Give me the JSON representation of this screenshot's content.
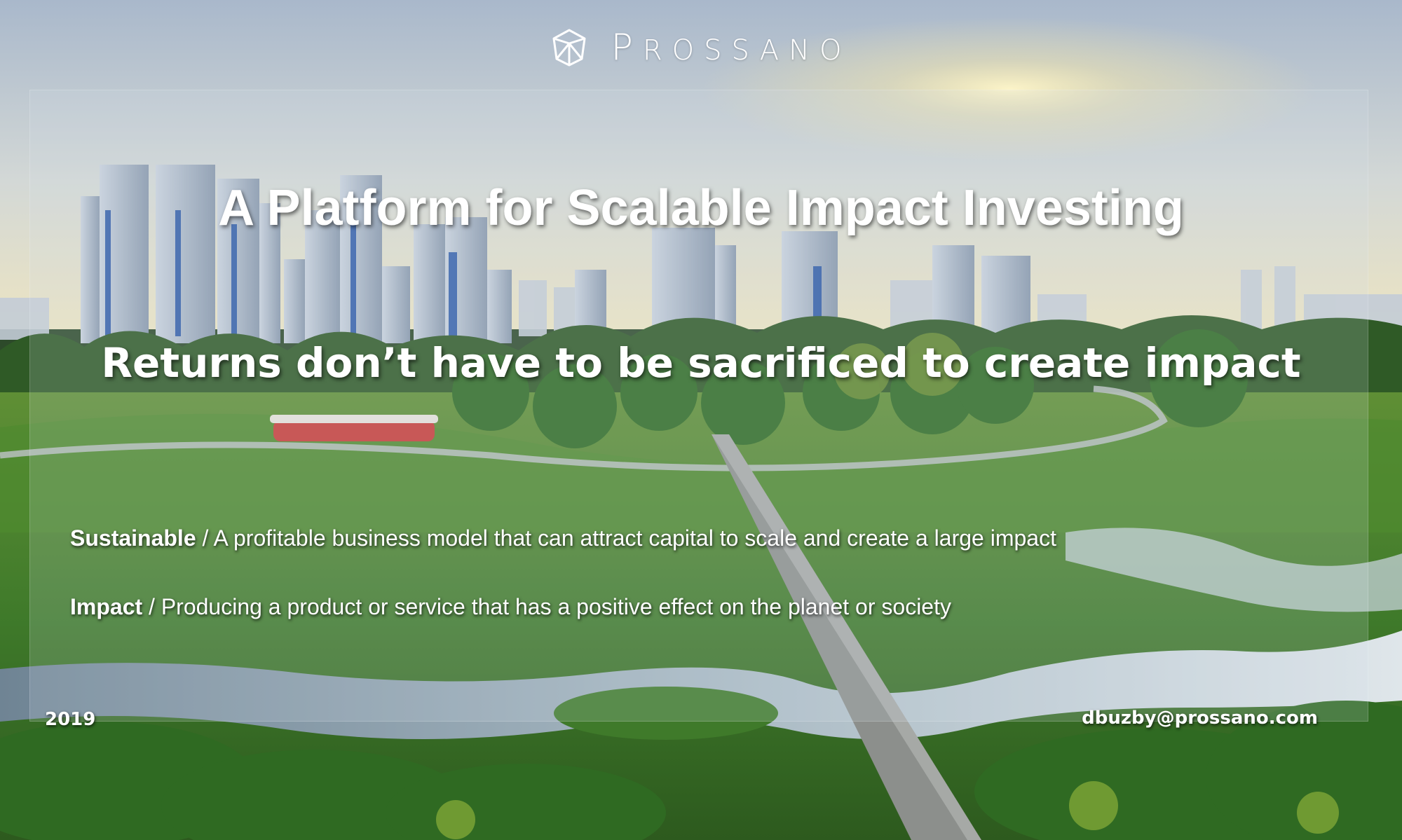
{
  "logo": {
    "icon": "geometric-gem-icon",
    "name": "PROSSANO",
    "first_letter": "P",
    "rest_letters": "ROSSANO"
  },
  "title": "A Platform for Scalable Impact Investing",
  "subtitle": "Returns don’t have to be sacrificed to create impact",
  "definitions": [
    {
      "term": "Sustainable",
      "separator": " / ",
      "text": "A profitable business model that can attract capital to scale and create a large impact"
    },
    {
      "term": "Impact",
      "separator": " / ",
      "text": "Producing a product or service that has a positive effect on the planet or society"
    }
  ],
  "footer": {
    "year": "2019",
    "email": "dbuzby@prossano.com"
  },
  "colors": {
    "sky_top": "#aab9cc",
    "sky_horizon": "#e8e4c8",
    "grass": "#3f7a2a",
    "water": "#8fa3b0",
    "text": "#ffffff"
  }
}
